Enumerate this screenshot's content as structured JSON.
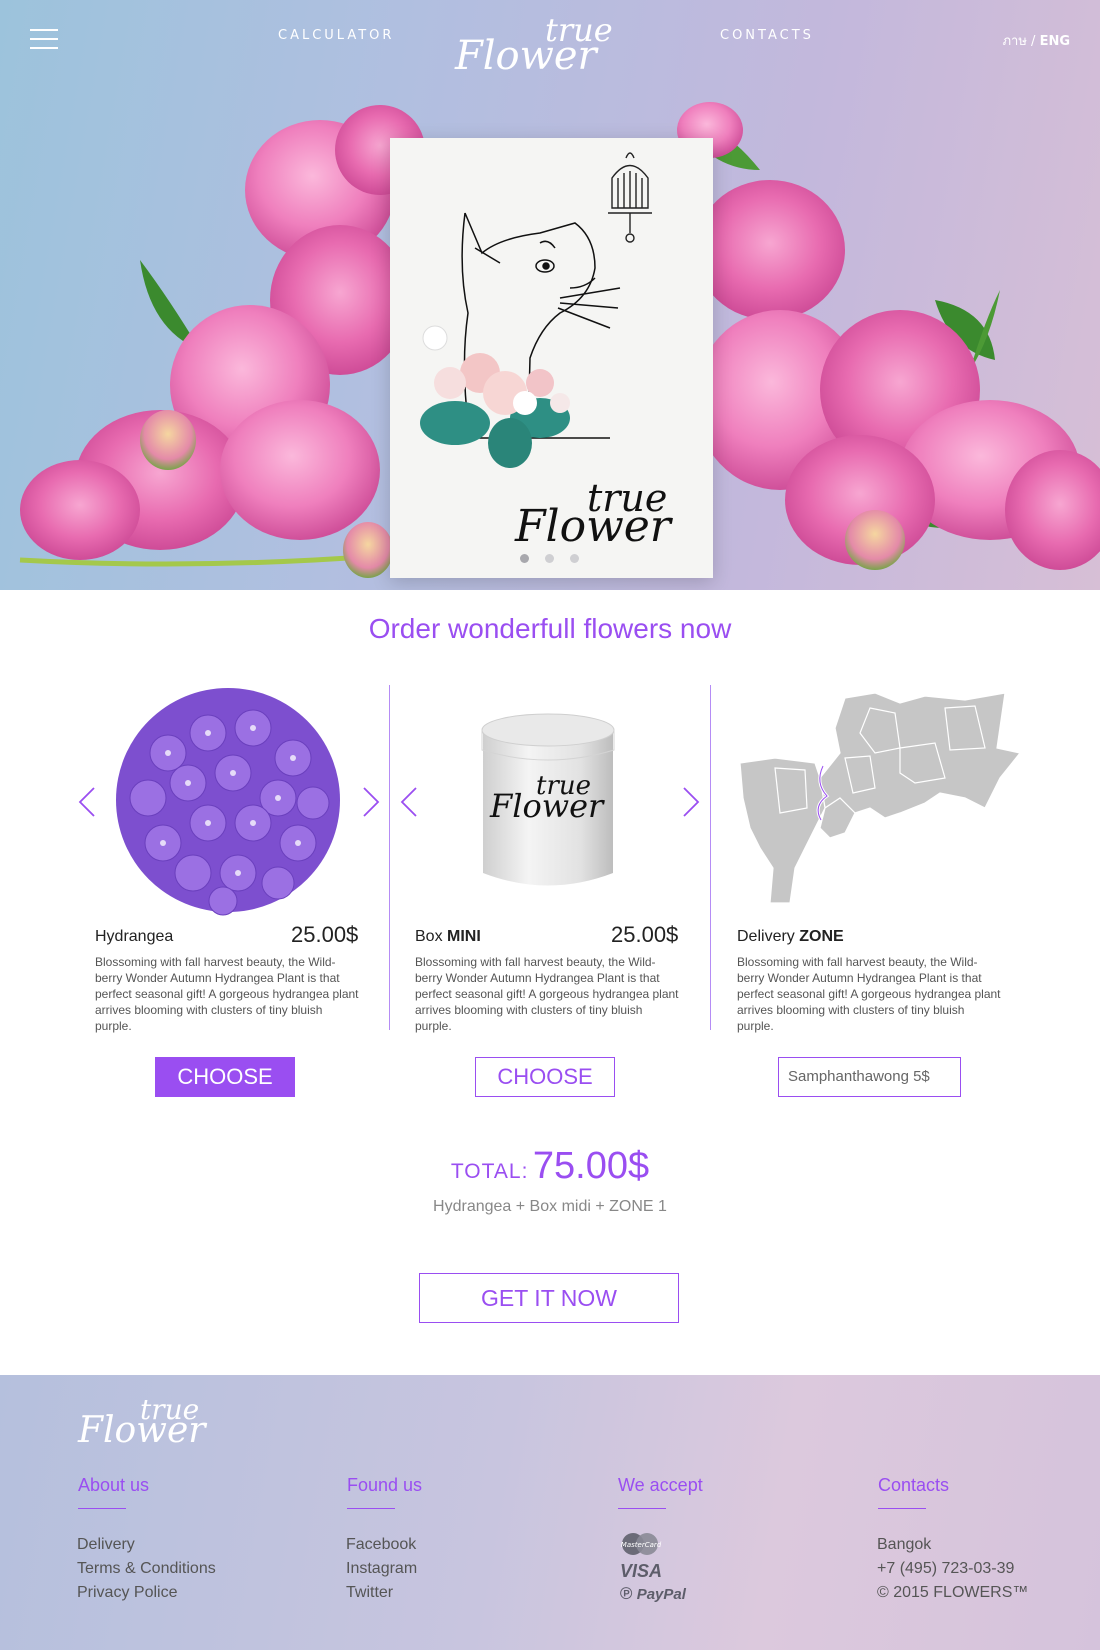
{
  "header": {
    "nav_left": "CALCULATOR",
    "nav_right": "CONTACTS",
    "logo_line1": "true",
    "logo_line2": "Flower",
    "lang_other": "ภาษ /",
    "lang_active": "ENG"
  },
  "hero": {
    "card_logo_line1": "true",
    "card_logo_line2": "Flower",
    "slides_total": 3,
    "active_slide": 1
  },
  "order": {
    "title": "Order wonderfull flowers now",
    "items": [
      {
        "name": "Hydrangea",
        "name_bold": "",
        "price": "25.00$",
        "description": "Blossoming with fall harvest beauty, the Wild-berry Wonder Autumn Hydrangea Plant is that perfect seasonal gift! A gorgeous hydrangea plant arrives blooming with clusters of tiny bluish purple.",
        "button": "CHOOSE",
        "selected": true
      },
      {
        "name": "Box ",
        "name_bold": "MINI",
        "price": "25.00$",
        "box_logo_line1": "true",
        "box_logo_line2": "Flower",
        "description": "Blossoming with fall harvest beauty, the Wild-berry Wonder Autumn Hydrangea Plant is that perfect seasonal gift! A gorgeous hydrangea plant arrives blooming with clusters of tiny bluish purple.",
        "button": "CHOOSE",
        "selected": false
      },
      {
        "name": "Delivery ",
        "name_bold": "ZONE",
        "description": "Blossoming with fall harvest beauty, the Wild-berry Wonder Autumn Hydrangea Plant is that perfect seasonal gift! A gorgeous hydrangea plant arrives blooming with clusters of tiny bluish purple.",
        "zone_value": "Samphanthawong  5$"
      }
    ],
    "total_label": "TOTAL:",
    "total_value": "75.00$",
    "total_summary": "Hydrangea + Box midi + ZONE 1",
    "cta": "GET IT NOW"
  },
  "footer": {
    "logo_line1": "true",
    "logo_line2": "Flower",
    "about": {
      "heading": "About us",
      "links": [
        "Delivery",
        "Terms & Conditions",
        "Privacy Police"
      ]
    },
    "found": {
      "heading": "Found us",
      "links": [
        "Facebook",
        "Instagram",
        "Twitter"
      ]
    },
    "accept": {
      "heading": "We accept",
      "methods": [
        "MasterCard",
        "VISA",
        "PayPal"
      ]
    },
    "contacts": {
      "heading": "Contacts",
      "lines": [
        "Bangok",
        "+7 (495) 723-03-39",
        "© 2015 FLOWERS™"
      ]
    }
  },
  "colors": {
    "accent": "#9a4ef1",
    "hero_gradient_start": "#9cc3dc",
    "hero_gradient_end": "#d7bfd6",
    "peony_pink": "#e86bb0",
    "hydrangea_purple": "#8b5bd6",
    "map_gray": "#c6c6c6"
  }
}
